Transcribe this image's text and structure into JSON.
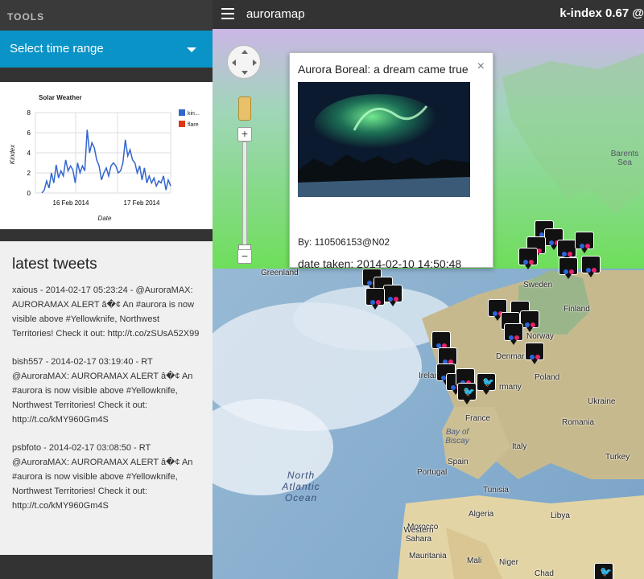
{
  "sidebar": {
    "header": "TOOLS",
    "time_range": {
      "label": "Select time range"
    },
    "chart": {
      "title": "Solar Weather",
      "legend": [
        "kin...",
        "flare"
      ]
    },
    "tweets": {
      "heading": "latest tweets",
      "items": [
        "xaious - 2014-02-17 05:23:24 - @AuroraMAX: AURORAMAX ALERT â�¢ An #aurora is now visible above #Yellowknife, Northwest Territories! Check it out: http://t.co/zSUsA52X99",
        "bish557 - 2014-02-17 03:19:40 - RT @AuroraMAX: AURORAMAX ALERT â�¢ An #aurora is now visible above #Yellowknife, Northwest Territories! Check it out: http://t.co/kMY960Gm4S",
        "psbfoto - 2014-02-17 03:08:50 - RT @AuroraMAX: AURORAMAX ALERT â�¢ An #aurora is now visible above #Yellowknife, Northwest Territories! Check it out: http://t.co/kMY960Gm4S"
      ]
    }
  },
  "topbar": {
    "title": "auroramap",
    "kindex": "k-index 0.67 @"
  },
  "popup": {
    "title": "Aurora Boreal: a dream came true",
    "close": "×",
    "by": "By:  110506153@N02",
    "date": "date taken: 2014-02-10 14:50:48"
  },
  "map": {
    "zoom_in": "+",
    "zoom_out": "−",
    "labels": {
      "greenland": "Greenland",
      "barents": "Barents Sea",
      "sweden": "Sweden",
      "finland": "Finland",
      "norway": "Norway",
      "denmark": "Denmark",
      "ireland": "Ireland",
      "poland": "Poland",
      "germany": "rmany",
      "ukraine": "Ukraine",
      "france": "France",
      "romania": "Romania",
      "bay": "Bay of Biscay",
      "italy": "Italy",
      "spain": "Spain",
      "turkey": "Turkey",
      "portugal": "Portugal",
      "ocean": "North Atlantic Ocean",
      "morocco": "Morocco",
      "algeria": "Algeria",
      "tunisia": "Tunisia",
      "western_sahara": "Western Sahara",
      "mauritania": "Mauritania",
      "mali": "Mali",
      "niger": "Niger",
      "chad": "Chad",
      "libya": "Libya"
    }
  },
  "chart_data": {
    "type": "line",
    "title": "Solar Weather",
    "xlabel": "Date",
    "ylabel": "Kindex",
    "ylim": [
      0,
      8
    ],
    "yticks": [
      0,
      2,
      4,
      6,
      8
    ],
    "xticks": [
      "16 Feb 2014",
      "17 Feb 2014"
    ],
    "legend_position": "right",
    "grid": true,
    "series": [
      {
        "name": "kin...",
        "color": "#3366cc",
        "values": [
          0,
          0.3,
          1.2,
          0.5,
          2.0,
          1.0,
          2.8,
          1.5,
          2.2,
          1.7,
          3.3,
          2.2,
          2.7,
          2.3,
          1.0,
          3.0,
          2.0,
          2.7,
          2.2,
          6.3,
          4.0,
          5.0,
          4.5,
          3.3,
          2.7,
          1.3,
          2.0,
          2.5,
          1.7,
          2.7,
          3.0,
          2.7,
          2.0,
          2.2,
          3.0,
          5.3,
          3.7,
          4.3,
          3.3,
          3.0,
          2.0,
          2.7,
          1.3,
          2.5,
          1.0,
          1.7,
          1.0,
          1.5,
          0.7,
          1.2,
          1.0,
          1.7,
          0.3,
          1.3,
          0.7
        ]
      },
      {
        "name": "flare",
        "color": "#dc3912",
        "values": []
      }
    ]
  }
}
